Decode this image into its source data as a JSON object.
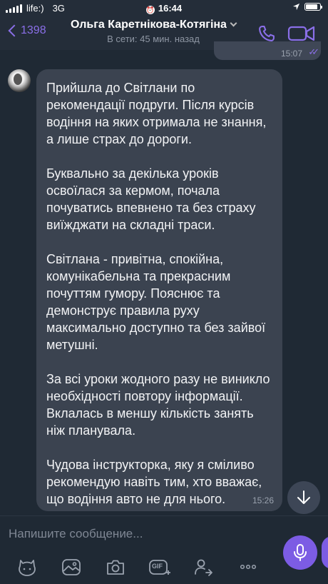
{
  "status_bar": {
    "carrier": "life:)",
    "network": "3G",
    "time": "16:44",
    "alarm_icon": "alarm-icon",
    "location_icon": "location-arrow-icon",
    "battery_level": 0.85
  },
  "header": {
    "back_count": "1398",
    "contact_name": "Ольга Каретнікова-Котягіна",
    "presence": "В сети: 45 мин. назад",
    "call_icon": "phone-icon",
    "video_icon": "video-camera-icon"
  },
  "previous_message": {
    "time": "15:07",
    "status_icon": "double-check-icon"
  },
  "message": {
    "paragraphs": [
      "Прийшла до Світлани по рекомендації подруги. Після курсів водіння на яких отримала не знання, а лише страх до дороги.",
      "Буквально за декілька уроків освоїлася за кермом, почала почуватись впевнено та без страху виїжджати на складні траси.",
      "Світлана - привітна, спокійна, комунікабельна та прекрасним почуттям гумору. Пояснює та демонструє правила руху максимально доступно та без зайвої метушні.",
      "За всі уроки жодного разу не виникло необхідності повтору інформації.  Вклалась в меншу кількість занять ніж планувала.",
      "Чудова інструкторка, яку я сміливо рекомендую навіть тим, хто вважає, що водіння авто не для нього."
    ],
    "time": "15:26"
  },
  "composer": {
    "placeholder": "Напишите сообщение...",
    "voice_icon": "microphone-icon",
    "tools": [
      "sticker-icon",
      "gallery-icon",
      "camera-icon",
      "gif-icon",
      "share-contact-icon",
      "more-icon"
    ],
    "gif_label": "GIF"
  },
  "colors": {
    "accent": "#7c5ce4",
    "background": "#1f2934",
    "bubble": "#3b4350"
  }
}
